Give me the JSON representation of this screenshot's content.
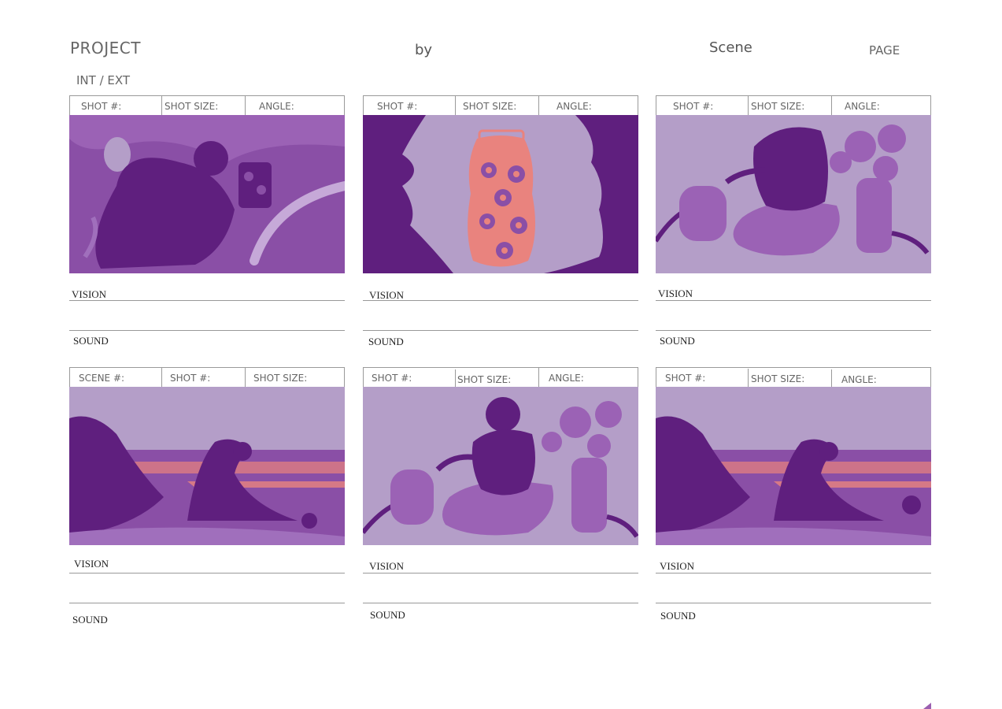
{
  "header": {
    "project_label": "PROJECT",
    "by_label": "by",
    "scene_label": "Scene",
    "page_label": "PAGE",
    "int_ext_label": "INT / EXT"
  },
  "colors": {
    "light_purple": "#b49ec8",
    "mid_purple": "#8a4fa6",
    "dark_purple": "#5f1f7e",
    "salmon": "#e9837e",
    "rule_gray": "#999999"
  },
  "panels": [
    {
      "fields": [
        "SHOT #:",
        "SHOT SIZE:",
        "ANGLE:"
      ],
      "image": "purple-painting-figure-with-jar",
      "vision_label": "VISION",
      "sound_label": "SOUND"
    },
    {
      "fields": [
        "SHOT #:",
        "SHOT SIZE:",
        "ANGLE:"
      ],
      "image": "patterned-jar-closeup",
      "vision_label": "VISION",
      "sound_label": "SOUND"
    },
    {
      "fields": [
        "SHOT #:",
        "SHOT SIZE:",
        "ANGLE:"
      ],
      "image": "figure-with-flowers-vase",
      "vision_label": "VISION",
      "sound_label": "SOUND"
    },
    {
      "fields": [
        "SCENE #:",
        "SHOT #:",
        "SHOT SIZE:"
      ],
      "image": "landscape-wave-shore",
      "vision_label": "VISION",
      "sound_label": "SOUND"
    },
    {
      "fields": [
        "SHOT #:",
        "SHOT SIZE:",
        "ANGLE:"
      ],
      "image": "figure-with-flowers-vase",
      "vision_label": "VISION",
      "sound_label": "SOUND"
    },
    {
      "fields": [
        "SHOT #:",
        "SHOT SIZE:",
        "ANGLE:"
      ],
      "image": "landscape-wave-shore",
      "vision_label": "VISION",
      "sound_label": "SOUND"
    }
  ]
}
